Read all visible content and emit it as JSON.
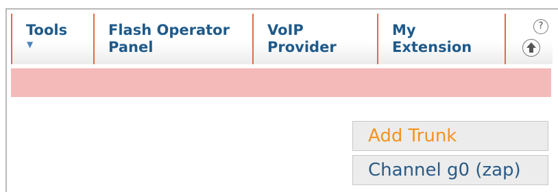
{
  "tabs": [
    {
      "label": "Tools",
      "has_dropdown": true
    },
    {
      "label": "Flash Operator Panel"
    },
    {
      "label": "VoIP Provider"
    },
    {
      "label": "My Extension"
    }
  ],
  "icons": {
    "help": "help-icon",
    "help_glyph": "?",
    "scroll_up": "arrow-up-circle-icon"
  },
  "actions": {
    "add_trunk": "Add Trunk",
    "channel": "Channel g0 (zap)"
  },
  "colors": {
    "tab_text": "#1f5a8a",
    "tab_separator": "#e06a4a",
    "status_bar": "#f4b9b9",
    "add_trunk_text": "#f29322",
    "channel_text": "#2a5a84"
  }
}
